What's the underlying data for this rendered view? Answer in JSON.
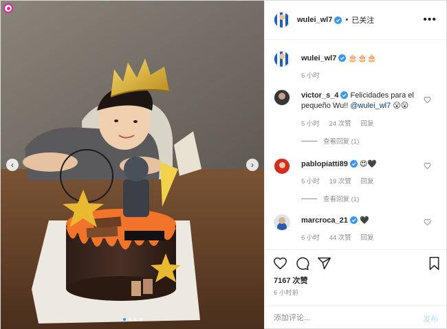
{
  "post": {
    "author": "wulei_wl7",
    "follow_state": "已关注",
    "header_separator": "•",
    "more_menu": "•••"
  },
  "caption": {
    "username": "wulei_wl7",
    "text": "🎂🎂🎂",
    "time": "6 小时"
  },
  "comments": [
    {
      "username": "victor_s_4",
      "text": "Felicidades para el pequeño Wu!!",
      "mention": "@wulei_wl7",
      "emoji": "😮😮",
      "time": "5 小时",
      "likes": "24 次赞",
      "reply": "回复",
      "view_replies": "查看回复 (1)"
    },
    {
      "username": "pablopiatti89",
      "text": "😍🖤",
      "time": "5 小时",
      "likes": "19 次赞",
      "reply": "回复",
      "view_replies": "查看回复 (1)"
    },
    {
      "username": "marcroca_21",
      "text": "🖤",
      "time": "6 小时",
      "likes": "44 次赞",
      "reply": "回复"
    }
  ],
  "engagement": {
    "likes": "7167 次赞",
    "time_ago": "6 小时前"
  },
  "comment_box": {
    "placeholder": "添加评论...",
    "post_label": "发布"
  },
  "carousel": {
    "slide_count": 4,
    "active_index": 0
  },
  "icons": {
    "verified": "verified-badge-icon",
    "like": "heart-icon",
    "comment": "comment-bubble-icon",
    "share": "paper-plane-icon",
    "save": "bookmark-icon",
    "nav_prev": "chevron-left-icon",
    "nav_next": "chevron-right-icon"
  },
  "colors": {
    "verified_blue": "#3897f0",
    "mention": "#003569",
    "muted_text": "#8e8e8e",
    "post_button_disabled": "#b2dffc"
  }
}
